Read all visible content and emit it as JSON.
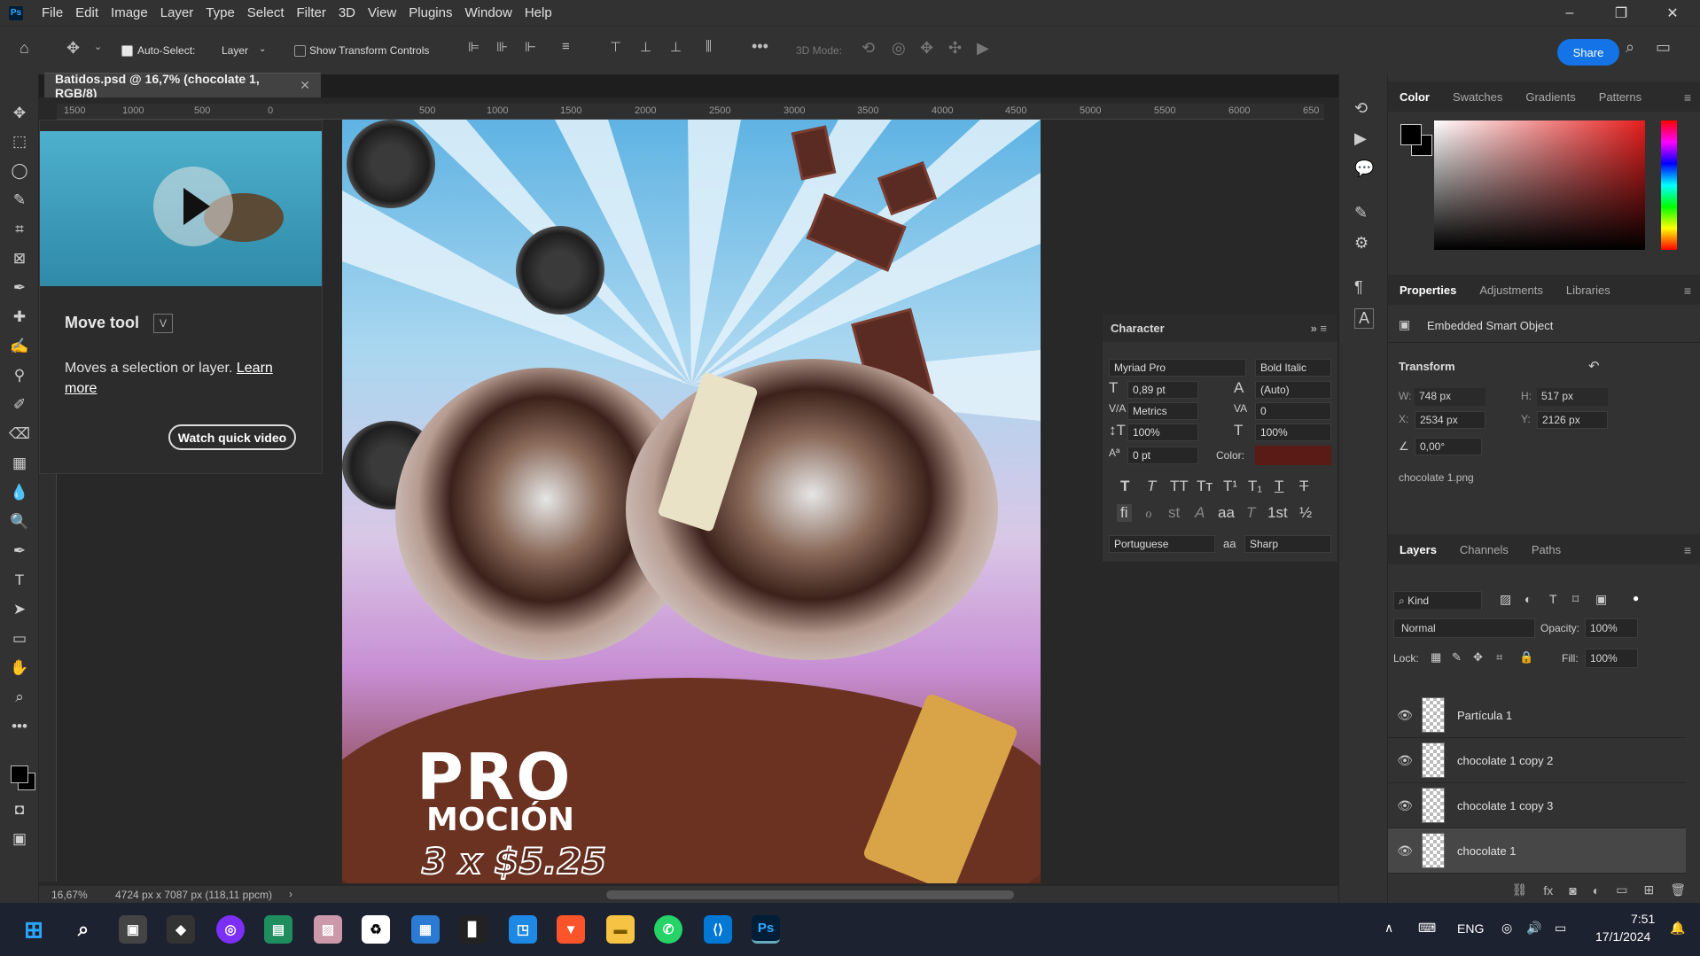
{
  "menubar": {
    "app_logo": "Ps",
    "items": [
      "File",
      "Edit",
      "Image",
      "Layer",
      "Type",
      "Select",
      "Filter",
      "3D",
      "View",
      "Plugins",
      "Window",
      "Help"
    ],
    "window_controls": [
      "minimize-icon",
      "restore-icon",
      "close-icon"
    ]
  },
  "options": {
    "auto_select_label": "Auto-Select:",
    "auto_select_checked": true,
    "auto_select_target": "Layer",
    "transform_controls_label": "Show Transform Controls",
    "more": "•••",
    "mode_3d_label": "3D Mode:",
    "share_label": "Share"
  },
  "document": {
    "tab_title": "Batidos.psd @ 16,7% (chocolate 1, RGB/8)",
    "zoom": "16,67%",
    "dimensions": "4724 px x 7087 px (118,11 ppcm)"
  },
  "ruler_top": [
    "1500",
    "1000",
    "500",
    "0",
    "500",
    "1000",
    "1500",
    "2000",
    "2500",
    "3000",
    "3500",
    "4000",
    "4500",
    "5000",
    "5500",
    "6000",
    "650"
  ],
  "tooltip": {
    "title": "Move tool",
    "shortcut": "V",
    "desc": "Moves a selection or layer.",
    "link": "Learn more",
    "button": "Watch quick video"
  },
  "artwork": {
    "line1": "PRO",
    "line2": "MOCIÓN",
    "line3": "3 x $5.25"
  },
  "character": {
    "title": "Character",
    "font_family": "Myriad Pro",
    "font_style": "Bold Italic",
    "size": "0,89 pt",
    "leading": "(Auto)",
    "kerning": "Metrics",
    "tracking": "0",
    "vscale": "100%",
    "hscale": "100%",
    "baseline": "0 pt",
    "color_label": "Color:",
    "color": "#5a1a16",
    "language": "Portuguese",
    "aa_icon": "aa",
    "antialias": "Sharp",
    "style_glyphs": [
      "T",
      "T",
      "TT",
      "Tт",
      "T¹",
      "T₁",
      "T",
      "T"
    ],
    "ot_glyphs": [
      "fi",
      "ℴ",
      "st",
      "A",
      "aa",
      "T",
      "1st",
      "½"
    ]
  },
  "color_panel": {
    "tabs": [
      "Color",
      "Swatches",
      "Gradients",
      "Patterns"
    ],
    "active": "Color"
  },
  "properties": {
    "tabs": [
      "Properties",
      "Adjustments",
      "Libraries"
    ],
    "type": "Embedded Smart Object",
    "transform_label": "Transform",
    "w_label": "W:",
    "w": "748 px",
    "h_label": "H:",
    "h": "517 px",
    "x_label": "X:",
    "x": "2534 px",
    "y_label": "Y:",
    "y": "2126 px",
    "angle": "0,00°",
    "file": "chocolate 1.png"
  },
  "layers_panel": {
    "tabs": [
      "Layers",
      "Channels",
      "Paths"
    ],
    "kind": "Kind",
    "blend": "Normal",
    "opacity_label": "Opacity:",
    "opacity": "100%",
    "lock_label": "Lock:",
    "fill_label": "Fill:",
    "fill": "100%",
    "layers": [
      {
        "name": "Partícula 1",
        "selected": false
      },
      {
        "name": "chocolate 1 copy 2",
        "selected": false
      },
      {
        "name": "chocolate 1 copy 3",
        "selected": false
      },
      {
        "name": "chocolate 1",
        "selected": true
      }
    ]
  },
  "taskbar": {
    "lang": "ENG",
    "time": "7:51",
    "date": "17/1/2024"
  }
}
